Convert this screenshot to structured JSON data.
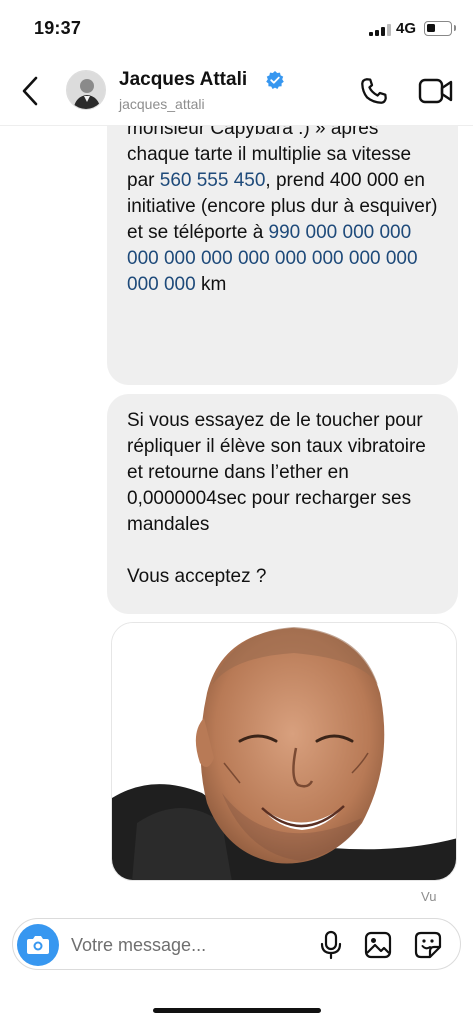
{
  "status_bar": {
    "time": "19:37",
    "network": "4G"
  },
  "header": {
    "contact_name": "Jacques Attali",
    "username": "jacques_attali",
    "verified": true
  },
  "messages": [
    {
      "sender": "other",
      "segments": [
        {
          "text": "+ si vous oubliez de dire « Merci monsieur Capybara :) » après chaque tarte il multiplie sa vitesse par ",
          "link": false
        },
        {
          "text": "560 555 450",
          "link": true
        },
        {
          "text": ", prend 400 000 en initiative (encore plus dur à esquiver) et se téléporte à ",
          "link": false
        },
        {
          "text": "990 000 000 000 000 000 000 000 000 000 000 000 000 000",
          "link": true
        },
        {
          "text": " km",
          "link": false
        }
      ]
    },
    {
      "sender": "other",
      "text": "Si vous essayez de le toucher pour répliquer il élève son taux vibratoire et retourne dans l’ether en 0,0000004sec pour recharger ses mandales\n\nVous acceptez ?"
    }
  ],
  "seen_label": "Vu",
  "composer": {
    "placeholder": "Votre message..."
  },
  "icons": [
    "back-chevron-icon",
    "verified-badge-icon",
    "phone-icon",
    "video-camera-icon",
    "camera-icon",
    "microphone-icon",
    "gallery-icon",
    "sticker-icon"
  ],
  "colors": {
    "accent": "#3797f0",
    "bubble": "#efefef",
    "number_link": "#1e4a7a",
    "muted": "#8e8e8e"
  }
}
